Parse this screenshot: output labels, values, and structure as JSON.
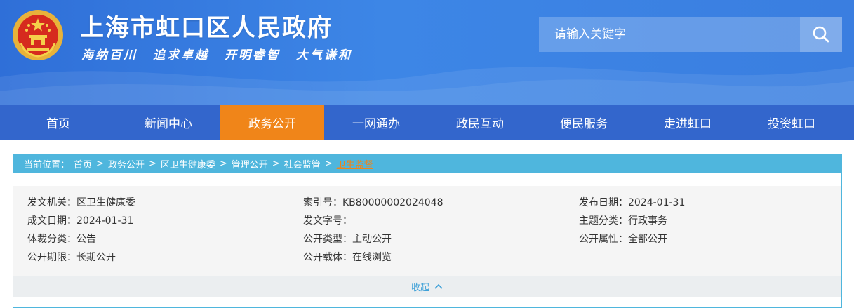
{
  "header": {
    "site_title": "上海市虹口区人民政府",
    "slogans": [
      "海纳百川",
      "追求卓越",
      "开明睿智",
      "大气谦和"
    ],
    "emblem_icon": "national-emblem-icon",
    "search": {
      "placeholder": "请输入关键字",
      "value": "",
      "icon": "search-icon"
    }
  },
  "nav": {
    "items": [
      {
        "label": "首页"
      },
      {
        "label": "新闻中心"
      },
      {
        "label": "政务公开",
        "active": true
      },
      {
        "label": "一网通办"
      },
      {
        "label": "政民互动"
      },
      {
        "label": "便民服务"
      },
      {
        "label": "走进虹口"
      },
      {
        "label": "投资虹口"
      }
    ],
    "colors": {
      "bar": "#3366cc",
      "active": "#f08519"
    }
  },
  "breadcrumb": {
    "prefix": "当前位置：",
    "sep": ">",
    "items": [
      "首页",
      "政务公开",
      "区卫生健康委",
      "管理公开",
      "社会监管",
      "卫生监督"
    ]
  },
  "meta": {
    "rows": [
      [
        "发文机关：区卫生健康委",
        "索引号：KB80000002024048",
        "发布日期：2024-01-31"
      ],
      [
        "成文日期：2024-01-31",
        "发文字号：",
        "主题分类：行政事务"
      ],
      [
        "体裁分类：公告",
        "公开类型：主动公开",
        "公开属性：全部公开"
      ],
      [
        "公开期限：长期公开",
        "公开载体：在线浏览",
        ""
      ]
    ]
  },
  "collapse": {
    "label": "收起",
    "icon": "chevron-up-icon"
  }
}
